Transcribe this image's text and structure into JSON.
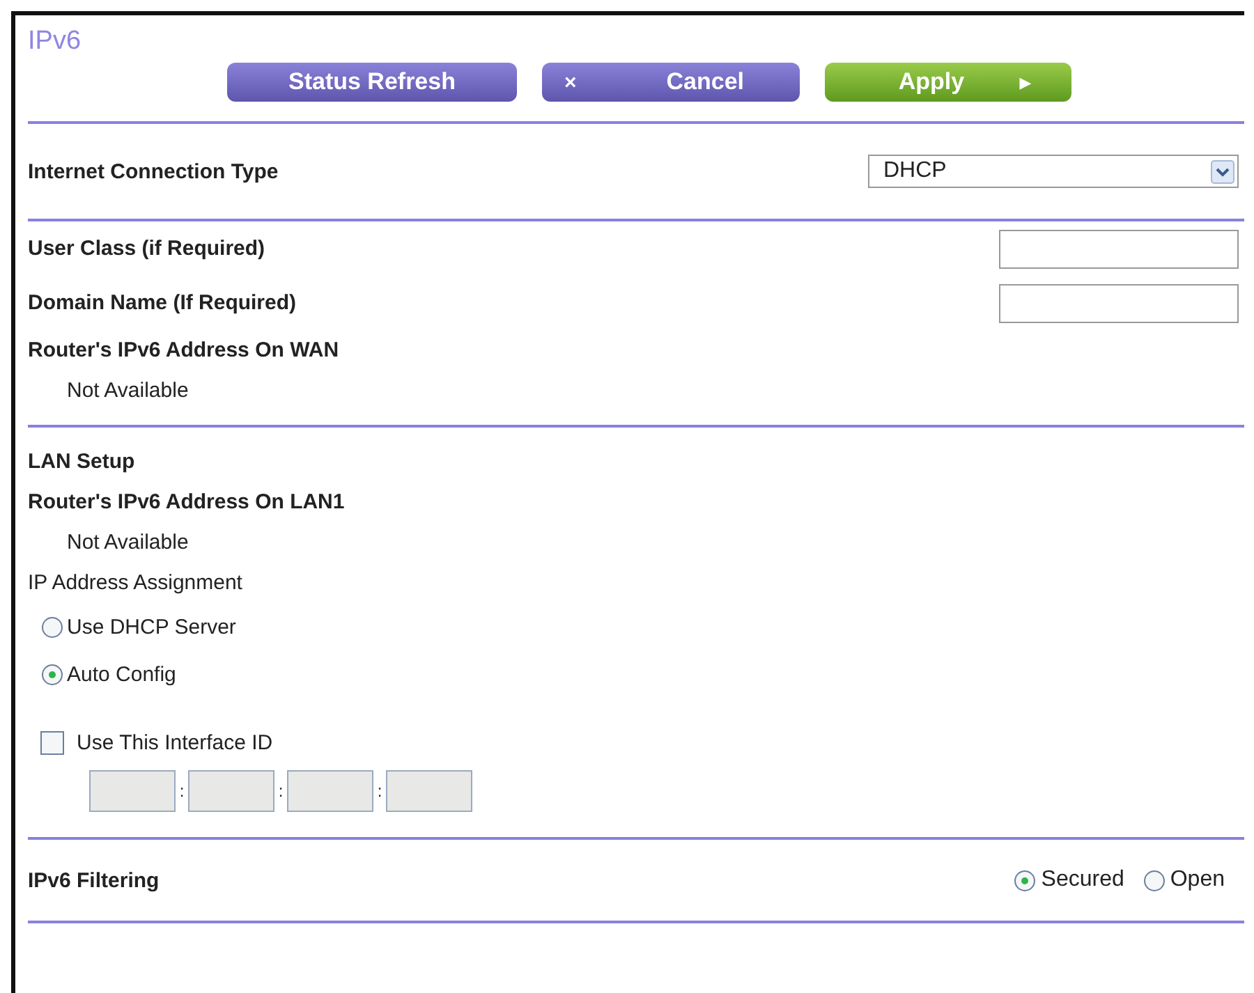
{
  "title": "IPv6",
  "buttons": [
    {
      "label": "Status Refresh",
      "kind": "plain"
    },
    {
      "label": "Cancel",
      "kind": "cancel",
      "icon_text": "×"
    },
    {
      "label": "Apply",
      "kind": "apply",
      "icon_text": "▸"
    }
  ],
  "connection_type": {
    "label": "Internet Connection Type",
    "value": "DHCP"
  },
  "wan": {
    "fields": [
      {
        "label": "User Class (if Required)"
      },
      {
        "label": "Domain Name  (If Required)"
      }
    ],
    "address_label": "Router's IPv6 Address On WAN",
    "address_value": "Not Available"
  },
  "lan": {
    "heading": "LAN Setup",
    "address_label": "Router's IPv6 Address On LAN1",
    "address_value": "Not Available",
    "assignment_label": "IP Address Assignment",
    "assignment_options": [
      {
        "label": "Use DHCP Server",
        "selected": false
      },
      {
        "label": "Auto Config",
        "selected": true
      }
    ],
    "interface_id": {
      "label": "Use This Interface ID",
      "checked": false,
      "separators": [
        ":",
        ":",
        ":"
      ]
    }
  },
  "filtering": {
    "label": "IPv6 Filtering",
    "options": [
      {
        "label": "Secured",
        "selected": true
      },
      {
        "label": "Open",
        "selected": false
      }
    ]
  }
}
